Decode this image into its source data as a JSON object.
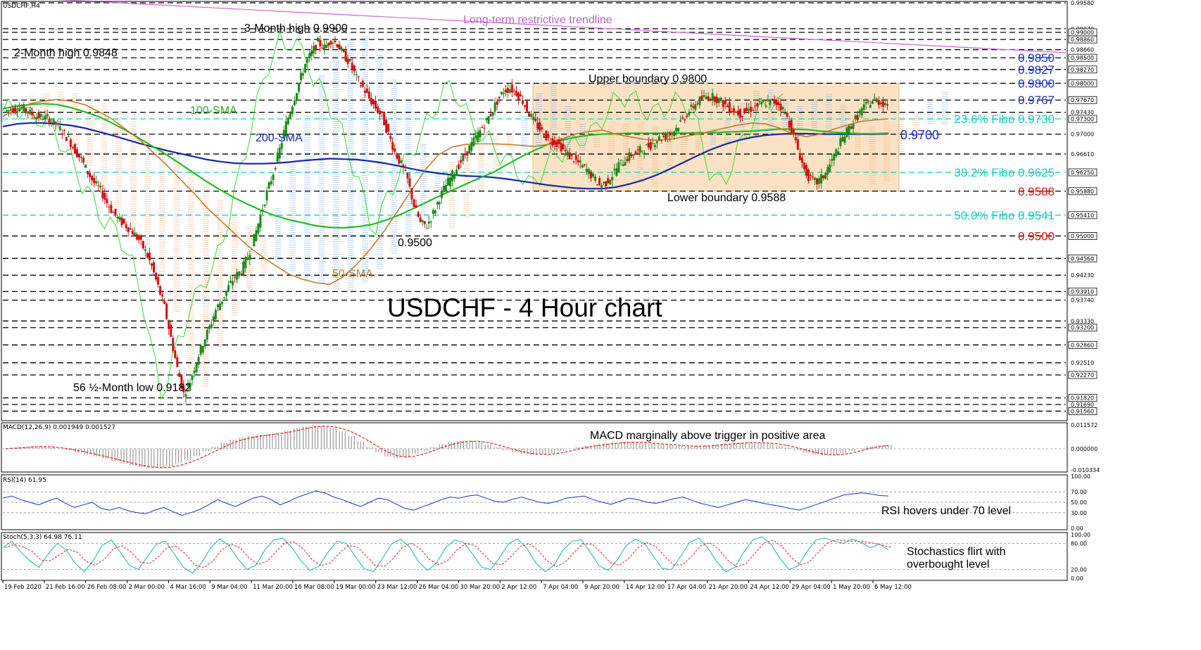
{
  "header": {
    "symbol": "USDCHF,H4"
  },
  "title": "USDCHF - 4 Hour chart",
  "chart_data": {
    "type": "candlestick",
    "title": "USDCHF - 4 Hour chart",
    "ylim": [
      0.914,
      0.9958
    ],
    "x_dates": [
      "19 Feb 2020",
      "21 Feb 16:00",
      "26 Feb 08:00",
      "2 Mar 00:00",
      "4 Mar 16:00",
      "9 Mar 04:00",
      "11 Mar 20:00",
      "16 Mar 08:00",
      "19 Mar 00:00",
      "23 Mar 12:00",
      "26 Mar 04:00",
      "30 Mar 20:00",
      "2 Apr 12:00",
      "7 Apr 04:00",
      "9 Apr 20:00",
      "14 Apr 12:00",
      "17 Apr 04:00",
      "21 Apr 20:00",
      "24 Apr 12:00",
      "29 Apr 04:00",
      "1 May 20:00",
      "6 May 12:00"
    ],
    "price_axis_labels": [
      "0.99580",
      "0.99070",
      "0.99000",
      "0.98860",
      "0.98660",
      "0.98500",
      "0.98270",
      "0.98000",
      "0.97670",
      "0.97430",
      "0.97300",
      "0.97000",
      "0.96610",
      "0.96250",
      "0.95880",
      "0.95410",
      "0.95000",
      "0.94560",
      "0.94230",
      "0.93910",
      "0.93740",
      "0.93330",
      "0.93200",
      "0.92860",
      "0.92510",
      "0.92270",
      "0.91820",
      "0.91690",
      "0.91560"
    ],
    "highlighted_price_labels": [
      "0.99000",
      "0.98860",
      "0.98500",
      "0.98270",
      "0.98000",
      "0.97670",
      "0.97300",
      "0.96250",
      "0.95880",
      "0.95410",
      "0.95000",
      "0.94560",
      "0.93910",
      "0.93200",
      "0.92860",
      "0.92270",
      "0.91820",
      "0.91560"
    ],
    "close_series": [
      0.9745,
      0.9748,
      0.9752,
      0.975,
      0.9741,
      0.9735,
      0.9733,
      0.9728,
      0.972,
      0.9705,
      0.969,
      0.9668,
      0.965,
      0.9625,
      0.9604,
      0.959,
      0.9565,
      0.9545,
      0.953,
      0.952,
      0.9508,
      0.9492,
      0.947,
      0.944,
      0.94,
      0.936,
      0.93,
      0.924,
      0.919,
      0.9215,
      0.9255,
      0.929,
      0.932,
      0.9355,
      0.9375,
      0.94,
      0.942,
      0.9432,
      0.946,
      0.9495,
      0.954,
      0.9585,
      0.9625,
      0.967,
      0.972,
      0.976,
      0.98,
      0.9838,
      0.986,
      0.988,
      0.987,
      0.9885,
      0.9878,
      0.9855,
      0.984,
      0.981,
      0.9792,
      0.977,
      0.9752,
      0.9735,
      0.97,
      0.9665,
      0.964,
      0.961,
      0.956,
      0.9525,
      0.952,
      0.9545,
      0.9575,
      0.96,
      0.962,
      0.964,
      0.966,
      0.968,
      0.97,
      0.972,
      0.974,
      0.9765,
      0.9785,
      0.979,
      0.9782,
      0.9765,
      0.974,
      0.972,
      0.9705,
      0.969,
      0.9685,
      0.9675,
      0.966,
      0.965,
      0.964,
      0.963,
      0.9615,
      0.96,
      0.9605,
      0.962,
      0.964,
      0.965,
      0.966,
      0.9666,
      0.9672,
      0.9679,
      0.969,
      0.9695,
      0.97,
      0.9712,
      0.973,
      0.9745,
      0.976,
      0.977,
      0.9775,
      0.9772,
      0.9764,
      0.9754,
      0.9746,
      0.974,
      0.9746,
      0.9752,
      0.9758,
      0.9762,
      0.9764,
      0.976,
      0.9742,
      0.971,
      0.967,
      0.963,
      0.961,
      0.9605,
      0.9618,
      0.964,
      0.9665,
      0.9692,
      0.9712,
      0.973,
      0.9748,
      0.976,
      0.9768,
      0.9762,
      0.976
    ],
    "series": [
      {
        "name": "50-SMA",
        "values": [
          0.9735,
          0.9748,
          0.976,
          0.9765,
          0.9768,
          0.9765,
          0.9758,
          0.9745,
          0.973,
          0.971,
          0.969,
          0.9665,
          0.964,
          0.9612,
          0.9585,
          0.9555,
          0.953,
          0.9505,
          0.948,
          0.946,
          0.9442,
          0.9425,
          0.9415,
          0.9408,
          0.9405,
          0.942,
          0.9445,
          0.9475,
          0.951,
          0.955,
          0.959,
          0.963,
          0.966,
          0.9675,
          0.968,
          0.9681,
          0.9681,
          0.968,
          0.9678,
          0.9676,
          0.968,
          0.969,
          0.97,
          0.9705,
          0.9708,
          0.97,
          0.9695,
          0.969,
          0.9688,
          0.969,
          0.9695,
          0.97,
          0.9706,
          0.9712,
          0.9718,
          0.9722,
          0.972,
          0.9712,
          0.97,
          0.9695,
          0.97,
          0.971,
          0.9718,
          0.9725,
          0.9728,
          0.973
        ]
      },
      {
        "name": "100-SMA",
        "values": [
          0.975,
          0.9755,
          0.9758,
          0.976,
          0.9758,
          0.9752,
          0.9744,
          0.9735,
          0.9722,
          0.9708,
          0.9692,
          0.9676,
          0.966,
          0.9642,
          0.9624,
          0.9606,
          0.959,
          0.9575,
          0.9562,
          0.955,
          0.954,
          0.9532,
          0.9526,
          0.952,
          0.9517,
          0.9516,
          0.9518,
          0.9522,
          0.953,
          0.954,
          0.9552,
          0.9565,
          0.9578,
          0.959,
          0.9602,
          0.9614,
          0.9625,
          0.964,
          0.9655,
          0.9668,
          0.968,
          0.9688,
          0.9694,
          0.9698,
          0.97,
          0.9701,
          0.9702,
          0.9702,
          0.9702,
          0.9702,
          0.9702,
          0.9703,
          0.9703,
          0.9704,
          0.9705,
          0.9706,
          0.9708,
          0.971,
          0.971,
          0.9709,
          0.9706,
          0.9704,
          0.9702,
          0.9701,
          0.9701,
          0.9702
        ]
      },
      {
        "name": "200-SMA",
        "values": [
          0.9715,
          0.972,
          0.9722,
          0.9722,
          0.972,
          0.9717,
          0.9712,
          0.9705,
          0.9698,
          0.969,
          0.9682,
          0.9675,
          0.9668,
          0.9662,
          0.9656,
          0.965,
          0.9646,
          0.9643,
          0.9642,
          0.9642,
          0.9643,
          0.9645,
          0.9648,
          0.965,
          0.9652,
          0.9651,
          0.965,
          0.9647,
          0.9643,
          0.9638,
          0.9632,
          0.9627,
          0.9623,
          0.962,
          0.9618,
          0.9617,
          0.9615,
          0.9612,
          0.9608,
          0.9604,
          0.96,
          0.9597,
          0.9594,
          0.9593,
          0.9593,
          0.9596,
          0.9602,
          0.961,
          0.962,
          0.9632,
          0.9645,
          0.9658,
          0.967,
          0.968,
          0.9688,
          0.9694,
          0.9698,
          0.97,
          0.9701,
          0.9701,
          0.97,
          0.97,
          0.97,
          0.97,
          0.97,
          0.9701
        ]
      }
    ],
    "horizontal_levels": [
      0.9958,
      0.9907,
      0.99,
      0.9886,
      0.9866,
      0.985,
      0.9827,
      0.98,
      0.9767,
      0.9743,
      0.973,
      0.97,
      0.9661,
      0.9625,
      0.9588,
      0.9541,
      0.95,
      0.9456,
      0.9423,
      0.9391,
      0.9374,
      0.9333,
      0.932,
      0.9286,
      0.9251,
      0.9227,
      0.9182,
      0.9169,
      0.9156
    ],
    "levels": [
      {
        "label": "0.9850",
        "value": 0.985,
        "color": "#1a2fd4"
      },
      {
        "label": "0.9827",
        "value": 0.9827,
        "color": "#1a2fd4"
      },
      {
        "label": "0.9800",
        "value": 0.98,
        "color": "#1a2fd4"
      },
      {
        "label": "0.9767",
        "value": 0.9767,
        "color": "#1a2fd4"
      },
      {
        "label": "23.6% Fibo 0.9730",
        "value": 0.973,
        "color": "#1ec8c8"
      },
      {
        "label": "38.2% Fibo 0.9625",
        "value": 0.9625,
        "color": "#1ec8c8"
      },
      {
        "label": "0.9588",
        "value": 0.9588,
        "color": "#e01010"
      },
      {
        "label": "50.0% Fibo 0.9541",
        "value": 0.9541,
        "color": "#1ec8c8"
      },
      {
        "label": "0.9500",
        "value": 0.95,
        "color": "#e01010"
      }
    ],
    "range_box": {
      "upper": 0.98,
      "lower": 0.9588
    },
    "trendline": {
      "label": "Long-term restrictive trendline",
      "start": 0.997,
      "end": 0.986
    },
    "annotations": {
      "three_month_high": "3-Month high 0.9900",
      "two_month_high": "2-Month high 0.9848",
      "upper_boundary": "Upper boundary 0.9800",
      "lower_boundary": "Lower boundary 0.9588",
      "low": "56 ½-Month low 0.9182",
      "level_9500": "0.9500",
      "level_9700": "0.9700",
      "sma100": "100-SMA",
      "sma200": "200-SMA",
      "sma50": "50-SMA"
    }
  },
  "macd": {
    "header": "MACD(12,26,9) 0.001949 0.001527",
    "axis_labels": [
      "0.011572",
      "0.000000",
      "-0.010334"
    ],
    "ylim": [
      -0.0103,
      0.0116
    ],
    "histogram": [
      0.0,
      0.0005,
      0.001,
      0.0012,
      0.001,
      0.0006,
      0.0,
      -0.0008,
      -0.0018,
      -0.0028,
      -0.0038,
      -0.0048,
      -0.006,
      -0.0072,
      -0.0082,
      -0.009,
      -0.0094,
      -0.0092,
      -0.0085,
      -0.0072,
      -0.0055,
      -0.0035,
      -0.0012,
      0.001,
      0.003,
      0.0045,
      0.0055,
      0.0062,
      0.0068,
      0.0072,
      0.0078,
      0.0088,
      0.01,
      0.0108,
      0.0112,
      0.011,
      0.01,
      0.0085,
      0.0062,
      0.0035,
      0.0008,
      -0.0018,
      -0.0038,
      -0.0045,
      -0.0038,
      -0.0025,
      -0.001,
      0.0008,
      0.0022,
      0.0032,
      0.0038,
      0.0038,
      0.0032,
      0.002,
      0.0008,
      -0.0006,
      -0.0018,
      -0.0026,
      -0.003,
      -0.0028,
      -0.0022,
      -0.0012,
      0.0,
      0.0008,
      0.0015,
      0.0022,
      0.0026,
      0.003,
      0.0033,
      0.0032,
      0.0028,
      0.0024,
      0.002,
      0.0018,
      0.0014,
      0.001,
      0.0012,
      0.0016,
      0.002,
      0.0024,
      0.0028,
      0.003,
      0.003,
      0.0028,
      0.0024,
      0.0016,
      0.0006,
      -0.0008,
      -0.002,
      -0.0028,
      -0.0032,
      -0.003,
      -0.0022,
      -0.001,
      0.0004,
      0.0012,
      0.0016,
      0.0019
    ],
    "annotation": "MACD marginally above trigger in positive area"
  },
  "rsi": {
    "header": "RSI(14) 61.95",
    "axis_labels": [
      "100.00",
      "70.00",
      "50.00",
      "30.00",
      "0.00"
    ],
    "ylim": [
      0,
      100
    ],
    "values": [
      58,
      62,
      55,
      50,
      45,
      52,
      58,
      48,
      40,
      45,
      50,
      38,
      35,
      40,
      34,
      30,
      28,
      35,
      40,
      32,
      25,
      30,
      36,
      45,
      55,
      48,
      42,
      50,
      58,
      62,
      55,
      45,
      52,
      60,
      66,
      72,
      68,
      60,
      55,
      48,
      42,
      50,
      58,
      55,
      46,
      38,
      35,
      42,
      48,
      55,
      60,
      58,
      62,
      64,
      58,
      52,
      50,
      56,
      60,
      55,
      50,
      48,
      52,
      58,
      60,
      62,
      55,
      50,
      46,
      52,
      58,
      55,
      50,
      48,
      52,
      57,
      60,
      54,
      48,
      44,
      40,
      45,
      50,
      55,
      52,
      48,
      45,
      42,
      38,
      35,
      40,
      46,
      52,
      58,
      64,
      66,
      68,
      66,
      63,
      62
    ],
    "annotation": "RSI hovers under 70 level"
  },
  "stoch": {
    "header": "Stoch(5,3,3) 64.98 76.11",
    "axis_labels": [
      "100.00",
      "80.00",
      "20.00",
      "0.00"
    ],
    "ylim": [
      0,
      100
    ],
    "values": [
      70,
      85,
      60,
      40,
      25,
      55,
      80,
      65,
      35,
      15,
      40,
      75,
      88,
      60,
      30,
      20,
      50,
      78,
      85,
      55,
      25,
      12,
      35,
      70,
      90,
      75,
      45,
      20,
      30,
      65,
      88,
      92,
      70,
      40,
      18,
      28,
      60,
      85,
      80,
      50,
      22,
      15,
      45,
      78,
      90,
      72,
      38,
      18,
      35,
      70,
      88,
      82,
      55,
      25,
      20,
      48,
      80,
      90,
      68,
      35,
      15,
      30,
      65,
      85,
      88,
      60,
      28,
      18,
      42,
      75,
      90,
      80,
      50,
      22,
      20,
      50,
      82,
      92,
      70,
      38,
      15,
      25,
      60,
      88,
      95,
      78,
      45,
      20,
      28,
      62,
      88,
      92,
      85,
      80,
      90,
      82,
      70,
      78,
      65
    ],
    "annotation_line1": "Stochastics flirt with",
    "annotation_line2": "overbought level"
  },
  "colors": {
    "bull": "#1a8a1a",
    "bear": "#d01010",
    "sma50": "#c87a2a",
    "sma100": "#22c022",
    "sma200": "#1428a8",
    "trendline": "#d070d8",
    "range_box_fill": "#fbe2c4",
    "fib": "#1ec8c8",
    "resistance": "#1a2fd4",
    "support": "#e01010",
    "chikou": "#33dd33"
  }
}
